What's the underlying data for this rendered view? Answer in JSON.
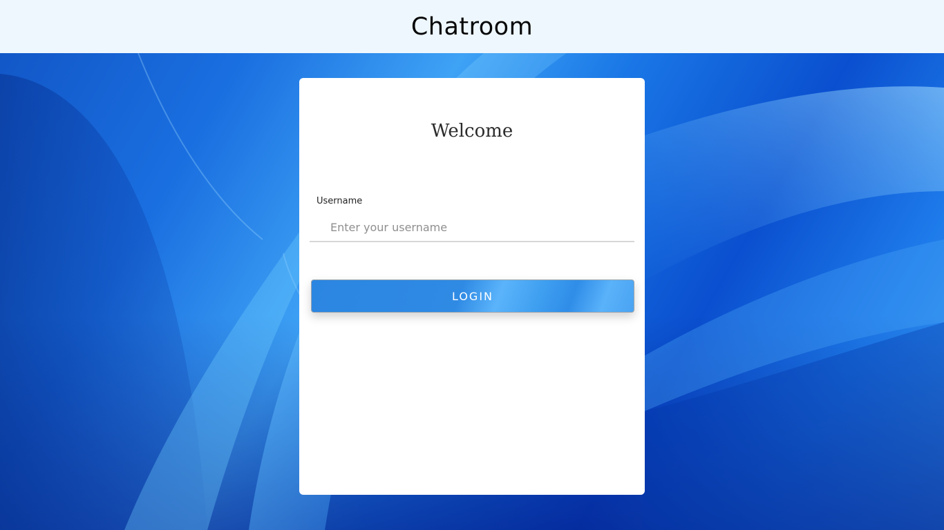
{
  "header": {
    "title": "Chatroom"
  },
  "login_card": {
    "title": "Welcome",
    "username_label": "Username",
    "username_placeholder": "Enter your username",
    "username_value": "",
    "login_label": "LOGIN"
  },
  "colors": {
    "header_background": "#eef7fe",
    "accent": "#2f8ae4",
    "card_background": "#ffffff",
    "page_background": "#1a6fe0"
  }
}
